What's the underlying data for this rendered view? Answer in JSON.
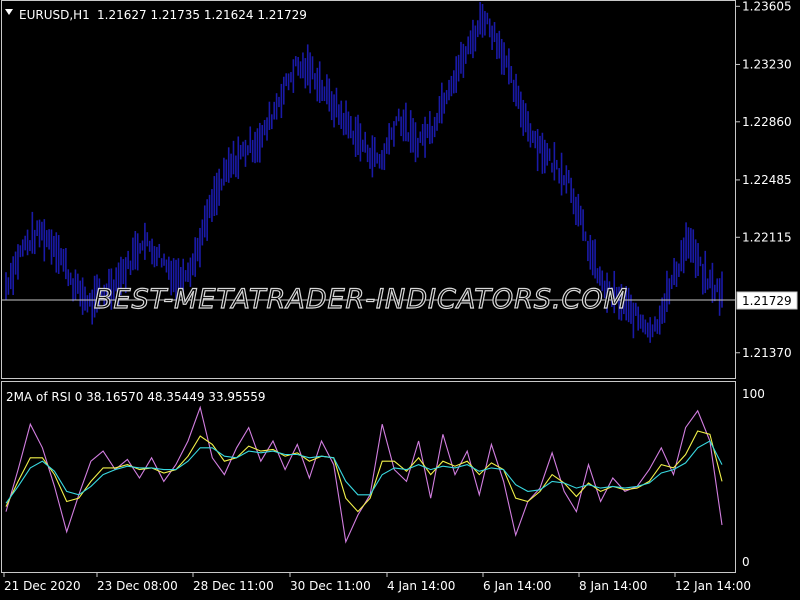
{
  "header": {
    "symbol": "EURUSD,H1",
    "ohlc": "1.21627 1.21735 1.21624 1.21729",
    "indicator": "2MA of RSI 0 38.16570 48.35449 33.95559"
  },
  "watermark": "BEST-METATRADER-INDICATORS.COM",
  "colors": {
    "background": "#000000",
    "price_bars": "#1a1aa8",
    "frame": "#c8c8c8",
    "rsi": "#d27ee0",
    "ma_fast": "#f2f24a",
    "ma_slow": "#38d8e0",
    "last_price_line": "#c8c8c8"
  },
  "icons": {
    "collapse": "triangle-down-icon"
  },
  "chart_data": [
    {
      "type": "bar",
      "title": "EURUSD,H1",
      "y_ticks": [
        "1.23605",
        "1.23230",
        "1.22860",
        "1.22485",
        "1.22115",
        "1.21370"
      ],
      "ylim": [
        1.2122,
        1.2362
      ],
      "last_price": "1.21729",
      "x_ticks": [
        "21 Dec 2020",
        "23 Dec 08:00",
        "28 Dec 11:00",
        "30 Dec 11:00",
        "4 Jan 14:00",
        "6 Jan 14:00",
        "8 Jan 14:00",
        "12 Jan 14:00"
      ],
      "series": [
        {
          "values": [
            1.218,
            1.2205,
            1.2215,
            1.2205,
            1.218,
            1.2168,
            1.2178,
            1.219,
            1.221,
            1.22,
            1.2185,
            1.2195,
            1.223,
            1.2255,
            1.2268,
            1.2275,
            1.23,
            1.2322,
            1.2318,
            1.23,
            1.2285,
            1.227,
            1.226,
            1.229,
            1.2272,
            1.2282,
            1.231,
            1.233,
            1.2355,
            1.2335,
            1.23,
            1.2275,
            1.226,
            1.225,
            1.221,
            1.218,
            1.217,
            1.216,
            1.2152,
            1.218,
            1.221,
            1.2185,
            1.2175
          ]
        }
      ]
    },
    {
      "type": "line",
      "title": "2MA of RSI 0 38.16570 48.35449 33.95559",
      "y_ticks": [
        "100",
        "0"
      ],
      "ylim": [
        0,
        100
      ],
      "x_ticks": [
        "21 Dec 2020",
        "23 Dec 08:00",
        "28 Dec 11:00",
        "30 Dec 11:00",
        "4 Jan 14:00",
        "6 Jan 14:00",
        "8 Jan 14:00",
        "12 Jan 14:00"
      ],
      "series": [
        {
          "values": [
            30,
            55,
            82,
            68,
            45,
            18,
            40,
            60,
            66,
            55,
            61,
            50,
            62,
            48,
            58,
            72,
            92,
            62,
            52,
            68,
            80,
            60,
            72,
            55,
            70,
            50,
            72,
            58,
            12,
            28,
            40,
            82,
            55,
            48,
            72,
            38,
            76,
            52,
            66,
            40,
            70,
            48,
            16,
            36,
            44,
            65,
            42,
            30,
            58,
            36,
            50,
            42,
            45,
            55,
            68,
            52,
            80,
            90,
            72,
            22
          ]
        },
        {
          "values": [
            33,
            48,
            62,
            62,
            52,
            36,
            38,
            48,
            56,
            56,
            58,
            55,
            56,
            53,
            55,
            63,
            75,
            70,
            60,
            62,
            69,
            66,
            67,
            63,
            65,
            60,
            63,
            62,
            38,
            30,
            38,
            60,
            60,
            54,
            62,
            52,
            60,
            57,
            60,
            52,
            59,
            55,
            38,
            36,
            42,
            52,
            47,
            39,
            47,
            42,
            45,
            43,
            44,
            48,
            58,
            56,
            64,
            78,
            76,
            48
          ]
        },
        {
          "values": [
            35,
            45,
            56,
            60,
            54,
            42,
            40,
            45,
            52,
            55,
            57,
            56,
            56,
            55,
            55,
            60,
            68,
            68,
            63,
            62,
            66,
            65,
            66,
            64,
            64,
            62,
            63,
            62,
            48,
            40,
            40,
            52,
            56,
            55,
            58,
            55,
            57,
            56,
            58,
            54,
            56,
            55,
            46,
            42,
            43,
            48,
            47,
            44,
            46,
            44,
            45,
            44,
            45,
            47,
            53,
            55,
            59,
            68,
            72,
            58
          ]
        }
      ]
    }
  ]
}
